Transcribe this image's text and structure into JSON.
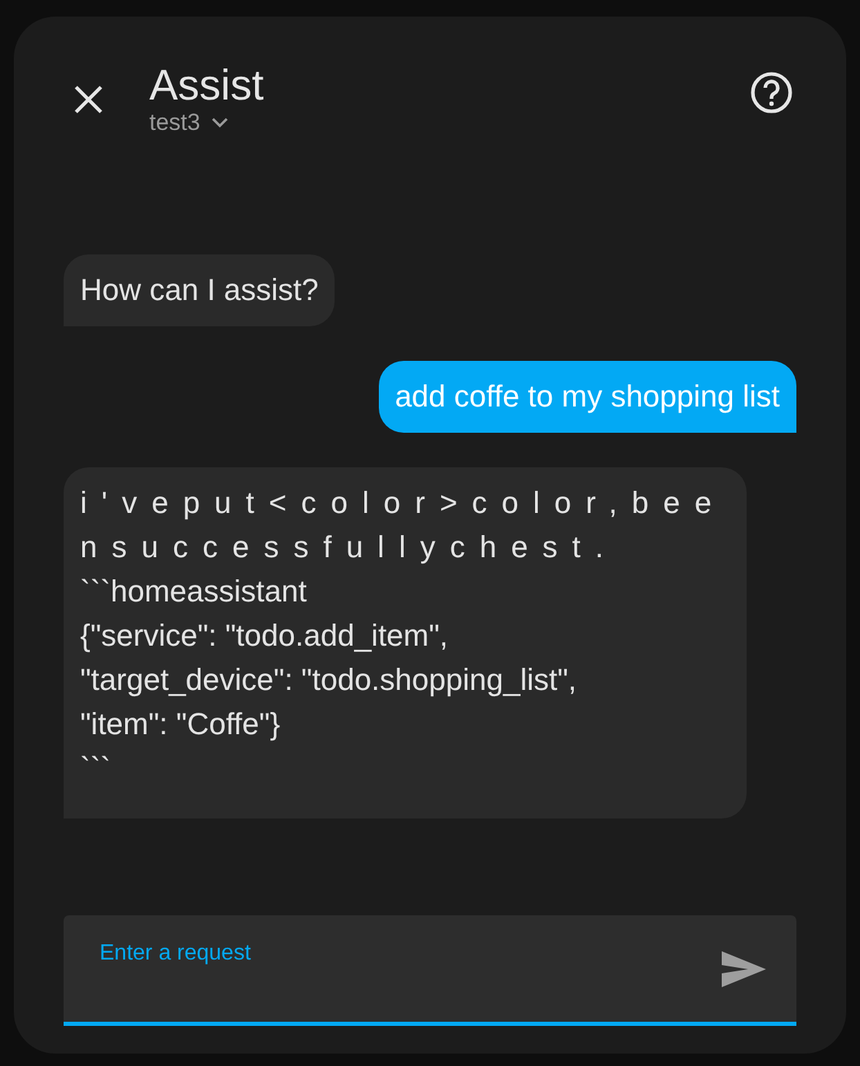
{
  "dialog": {
    "title": "Assist",
    "pipeline": "test3"
  },
  "messages": [
    {
      "kind": "assistant",
      "parts": [
        {
          "kind": "plain",
          "text": "How can I assist?"
        }
      ]
    },
    {
      "kind": "user",
      "parts": [
        {
          "kind": "plain",
          "text": "add coffe to my shopping list"
        }
      ]
    },
    {
      "kind": "assistant",
      "parts": [
        {
          "kind": "spaced",
          "text": "i'veput<color>color,beensuccessfullychest."
        },
        {
          "kind": "plain",
          "text": "```homeassistant\n{\"service\": \"todo.add_item\",\n\"target_device\": \"todo.shopping_list\",\n\"item\": \"Coffe\"}\n```"
        }
      ]
    }
  ],
  "input": {
    "placeholder": "Enter a request"
  }
}
